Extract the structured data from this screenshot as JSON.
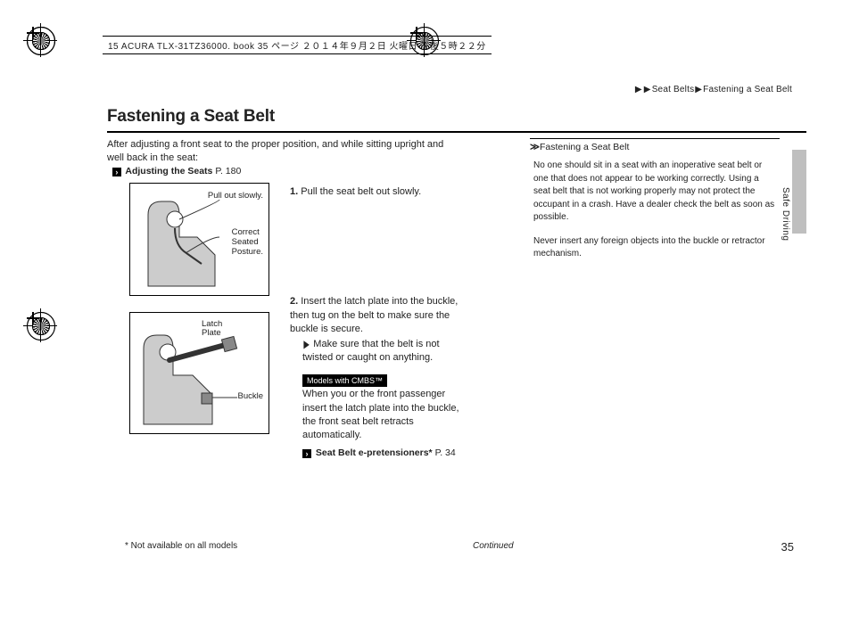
{
  "sourceline": "15 ACURA TLX-31TZ36000. book  35 ページ  ２０１４年９月２日  火曜日  午後５時２２分",
  "breadcrumb": {
    "a": "Seat Belts",
    "b": "Fastening a Seat Belt"
  },
  "title": "Fastening a Seat Belt",
  "intro": "After adjusting a front seat to the proper position, and while sitting upright and well back in the seat:",
  "xref1": {
    "label": "Adjusting the Seats",
    "page": "P. 180"
  },
  "fig1": {
    "lblA": "Pull out slowly.",
    "lblB": "Correct\nSeated\nPosture."
  },
  "fig2": {
    "lblA": "Latch\nPlate",
    "lblB": "Buckle"
  },
  "step1": {
    "num": "1.",
    "text": "Pull the seat belt out slowly."
  },
  "step2": {
    "num": "2.",
    "text": "Insert the latch plate into the buckle, then tug on the belt to make sure the buckle is secure.",
    "note": "Make sure that the belt is not twisted or caught on anything.",
    "badge": "Models with CMBS™",
    "aftertext": "When you or the front passenger insert the latch plate into the buckle, the front seat belt retracts automatically.",
    "xref": {
      "label": "Seat Belt e-pretensioners*",
      "page": "P. 34"
    }
  },
  "sidebox": {
    "heading": "Fastening a Seat Belt",
    "p1": "No one should sit in a seat with an inoperative seat belt or one that does not appear to be working correctly. Using a seat belt that is not working properly may not protect the occupant in a crash. Have a dealer check the belt as soon as possible.",
    "p2": "Never insert any foreign objects into the buckle or retractor mechanism."
  },
  "section_label": "Safe Driving",
  "footnote": "* Not available on all models",
  "continued": "Continued",
  "pagenum": "35"
}
